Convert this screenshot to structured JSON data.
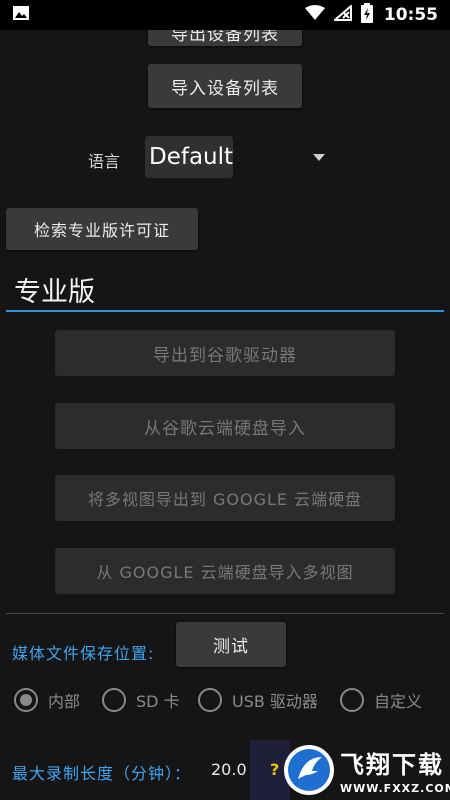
{
  "status_bar": {
    "time": "10:55",
    "icons": [
      "image-icon",
      "wifi-icon",
      "signal-icon",
      "battery-charging-icon"
    ]
  },
  "top_buttons": {
    "export_device_list": "导出设备列表",
    "import_device_list": "导入设备列表"
  },
  "language": {
    "label": "语言",
    "selected": "Default"
  },
  "retrieve_license_button": "检索专业版许可证",
  "pro_section_title": "专业版",
  "cloud_buttons": {
    "export_drive": "导出到谷歌驱动器",
    "import_drive": "从谷歌云端硬盘导入",
    "export_multiview": "将多视图导出到 GOOGLE 云端硬盘",
    "import_multiview": "从 GOOGLE 云端硬盘导入多视图"
  },
  "media": {
    "label": "媒体文件保存位置:",
    "test_button": "测试",
    "options": [
      {
        "label": "内部",
        "checked": true
      },
      {
        "label": "SD 卡",
        "checked": false
      },
      {
        "label": "USB 驱动器",
        "checked": false
      },
      {
        "label": "自定义",
        "checked": false
      }
    ]
  },
  "max_recording": {
    "label": "最大录制长度（分钟）：",
    "value": "20.0",
    "help": "?"
  },
  "watermark": {
    "title": "飞翔下载",
    "url": "WWW.FXXZ.COM"
  },
  "colors": {
    "accent": "#2f93e0",
    "label_blue": "#3fa3f0",
    "background": "#151515",
    "button": "#3a3a3a"
  }
}
